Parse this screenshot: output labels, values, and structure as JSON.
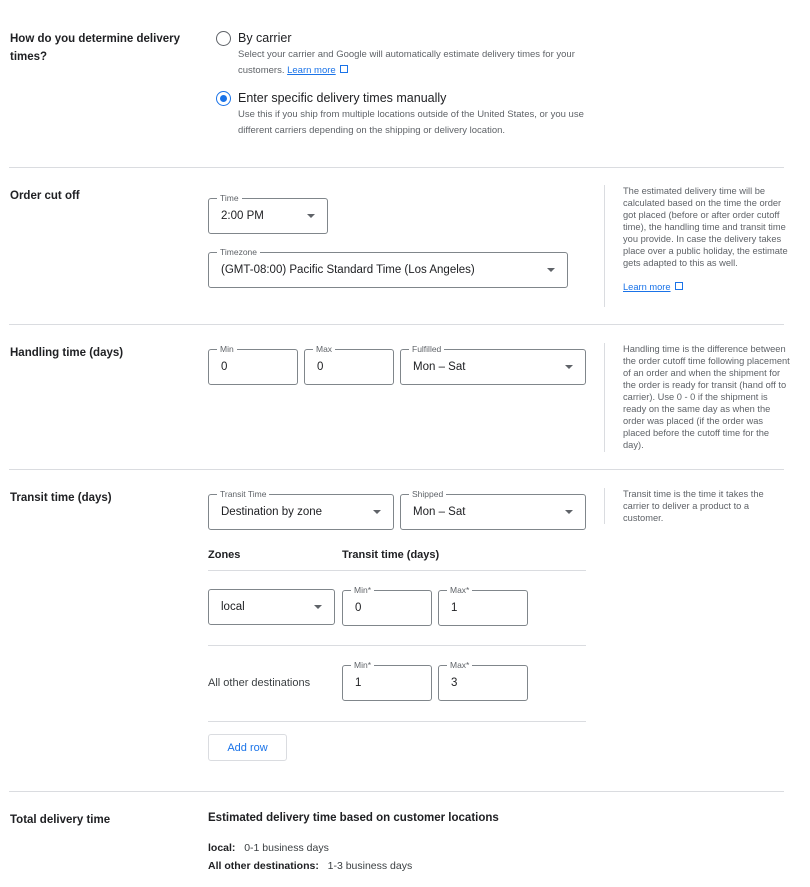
{
  "delivery_method": {
    "label": "How do you determine delivery times?",
    "options": [
      {
        "title": "By carrier",
        "desc": "Select your carrier and Google will automatically estimate delivery times for your customers.",
        "link": "Learn more",
        "selected": false
      },
      {
        "title": "Enter specific delivery times manually",
        "desc": "Use this if you ship from multiple locations outside of the United States, or you use different carriers depending on the shipping or delivery location.",
        "selected": true
      }
    ]
  },
  "order_cutoff": {
    "label": "Order cut off",
    "time_label": "Time",
    "time_value": "2:00 PM",
    "timezone_label": "Timezone",
    "timezone_value": "(GMT-08:00) Pacific Standard Time (Los Angeles)",
    "help": "The estimated delivery time will be calculated based on the time the order got placed (before or after order cutoff time), the handling time and transit time you provide. In case the delivery takes place over a public holiday, the estimate gets adapted to this as well.",
    "help_link": "Learn more"
  },
  "handling": {
    "label": "Handling time (days)",
    "min_label": "Min",
    "min_value": "0",
    "max_label": "Max",
    "max_value": "0",
    "fulfilled_label": "Fulfilled",
    "fulfilled_value": "Mon – Sat",
    "help": "Handling time is the difference between the order cutoff time following placement of an order and when the shipment for the order is ready for transit (hand off to carrier). Use 0 - 0 if the shipment is ready on the same day as when the order was placed (if the order was placed before the cutoff time for the day)."
  },
  "transit": {
    "label": "Transit time (days)",
    "type_label": "Transit Time",
    "type_value": "Destination by zone",
    "shipped_label": "Shipped",
    "shipped_value": "Mon – Sat",
    "help": "Transit time is the time it takes the carrier to deliver a product to a customer.",
    "zones_header": "Zones",
    "transit_header": "Transit time (days)",
    "rows": [
      {
        "zone": "local",
        "min_label": "Min*",
        "min": "0",
        "max_label": "Max*",
        "max": "1"
      },
      {
        "zone": "All other destinations",
        "min_label": "Min*",
        "min": "1",
        "max_label": "Max*",
        "max": "3"
      }
    ],
    "add_row": "Add row"
  },
  "total": {
    "label": "Total delivery time",
    "heading": "Estimated delivery time based on customer locations",
    "lines": [
      {
        "zone": "local:",
        "value": "0-1 business days"
      },
      {
        "zone": "All other destinations:",
        "value": "1-3 business days"
      }
    ]
  }
}
